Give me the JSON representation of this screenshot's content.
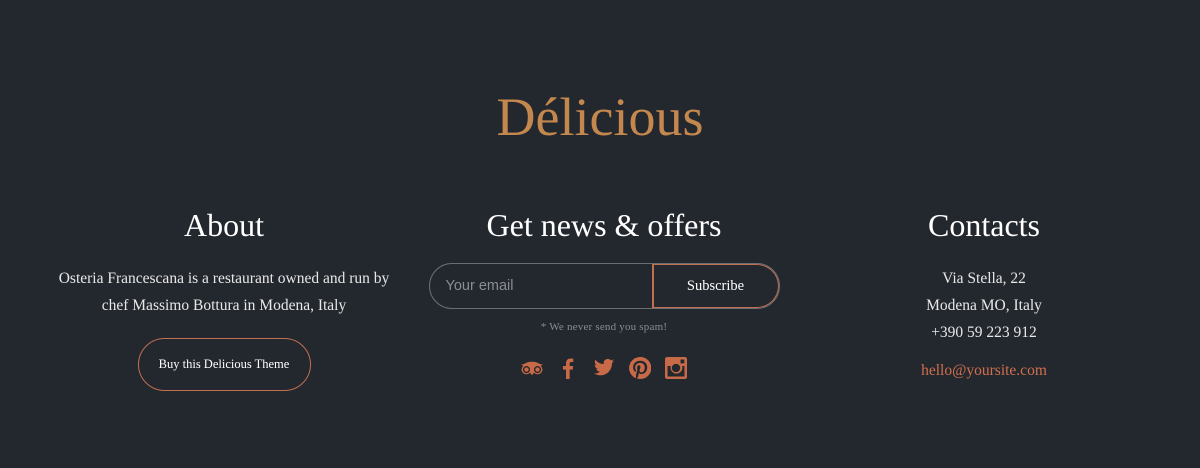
{
  "brand": {
    "name": "Délicious"
  },
  "about": {
    "title": "About",
    "text_line1": "Osteria Francescana is a restaurant owned and run by",
    "text_line2": "chef Massimo Bottura in Modena, Italy",
    "button_label": "Buy this Delicious Theme"
  },
  "news": {
    "title": "Get news & offers",
    "email_placeholder": "Your email",
    "subscribe_label": "Subscribe",
    "note": "* We never send you spam!",
    "social_icons": [
      "tripadvisor-icon",
      "facebook-icon",
      "twitter-icon",
      "pinterest-icon",
      "instagram-icon"
    ]
  },
  "contacts": {
    "title": "Contacts",
    "address_line1": "Via Stella, 22",
    "address_line2": "Modena MO, Italy",
    "phone": "+390 59 223 912",
    "email": "hello@yoursite.com"
  },
  "colors": {
    "background": "#23272e",
    "brand_gold": "#c4884e",
    "accent": "#c86a48"
  }
}
